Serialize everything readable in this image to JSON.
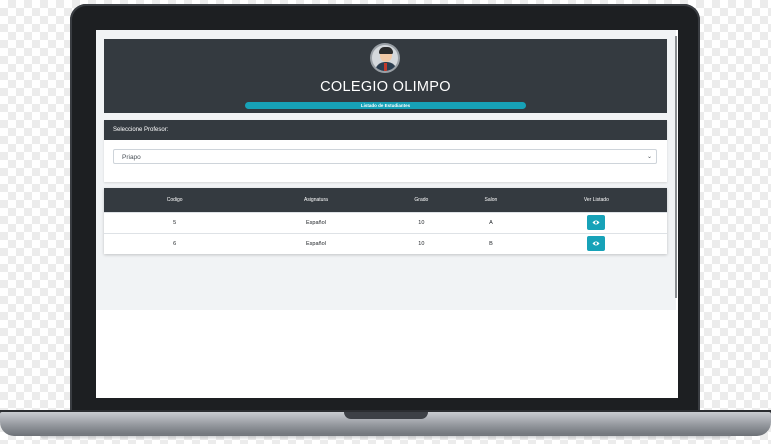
{
  "header": {
    "title": "COLEGIO OLIMPO",
    "subtitle": "Listado de Estudiantes"
  },
  "profesor_card": {
    "label": "Seleccione Profesor:",
    "selected": "Priapo"
  },
  "table": {
    "columns": [
      "Codigo",
      "Asignatura",
      "Grado",
      "Salon",
      "Ver Listado"
    ],
    "rows": [
      {
        "codigo": "5",
        "asignatura": "Español",
        "grado": "10",
        "salon": "A"
      },
      {
        "codigo": "6",
        "asignatura": "Español",
        "grado": "10",
        "salon": "B"
      }
    ]
  },
  "colors": {
    "dark": "#343a40",
    "accent": "#17a2b8"
  },
  "icons": {
    "avatar": "teacher-avatar",
    "row_action": "eye-icon",
    "select": "chevron-down-icon"
  }
}
